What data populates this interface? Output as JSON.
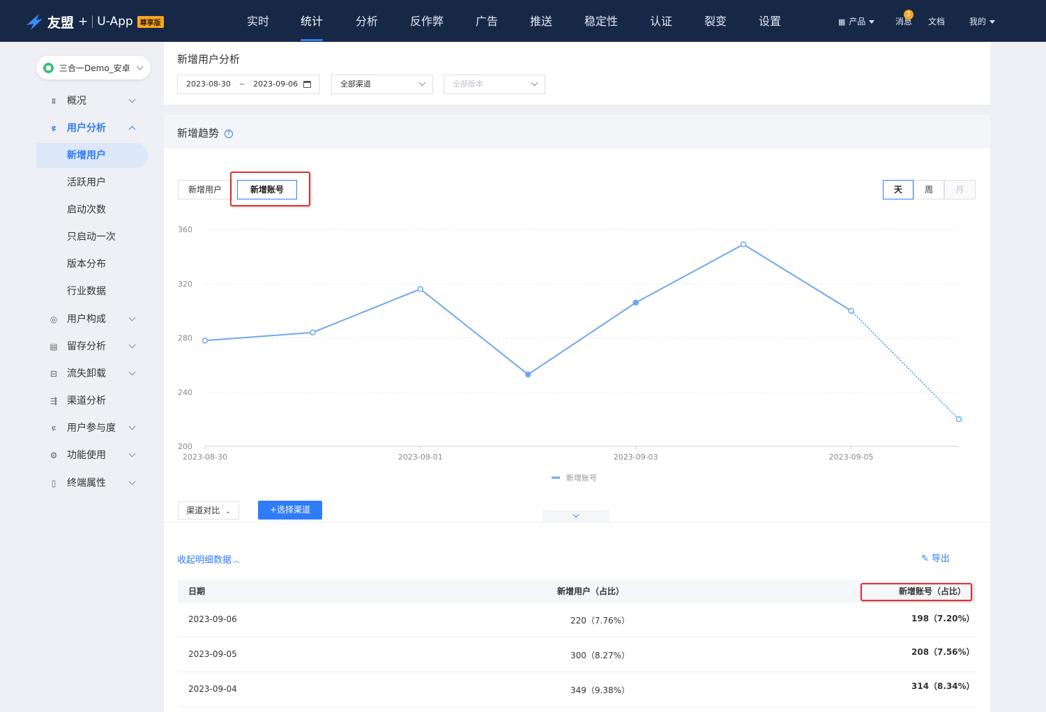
{
  "topnav": {
    "brand": "友盟",
    "plus": "+",
    "app": "U-App",
    "edition_badge": "尊享版",
    "items": [
      {
        "label": "实时"
      },
      {
        "label": "统计",
        "active": true
      },
      {
        "label": "分析"
      },
      {
        "label": "反作弊"
      },
      {
        "label": "广告"
      },
      {
        "label": "推送"
      },
      {
        "label": "稳定性"
      },
      {
        "label": "认证"
      },
      {
        "label": "裂变"
      },
      {
        "label": "设置"
      }
    ],
    "products_label": "产品",
    "messages_label": "消息",
    "messages_count": "2",
    "docs_label": "文档",
    "me_label": "我的"
  },
  "sidebar": {
    "app_selector": "三合一Demo_安卓",
    "items": [
      {
        "label": "概况",
        "icon": "chart-icon",
        "expandable": true
      },
      {
        "label": "用户分析",
        "icon": "user-analysis-icon",
        "expandable": true,
        "expanded": true
      },
      {
        "label": "新增用户",
        "sub": true,
        "active": true
      },
      {
        "label": "活跃用户",
        "sub": true
      },
      {
        "label": "启动次数",
        "sub": true
      },
      {
        "label": "只启动一次",
        "sub": true
      },
      {
        "label": "版本分布",
        "sub": true
      },
      {
        "label": "行业数据",
        "sub": true
      },
      {
        "label": "用户构成",
        "icon": "user-composition-icon",
        "expandable": true
      },
      {
        "label": "留存分析",
        "icon": "retention-icon",
        "expandable": true
      },
      {
        "label": "流失卸载",
        "icon": "churn-icon",
        "expandable": true
      },
      {
        "label": "渠道分析",
        "icon": "channel-icon",
        "expandable": false
      },
      {
        "label": "用户参与度",
        "icon": "engagement-icon",
        "expandable": true
      },
      {
        "label": "功能使用",
        "icon": "feature-icon",
        "expandable": true
      },
      {
        "label": "终端属性",
        "icon": "device-icon",
        "expandable": true
      }
    ]
  },
  "filters": {
    "title": "新增用户分析",
    "date_start": "2023-08-30",
    "date_sep": "~",
    "date_end": "2023-09-06",
    "channel": "全部渠道",
    "version_placeholder": "全部版本"
  },
  "trend": {
    "title": "新增趋势",
    "help": "?",
    "tabs": [
      {
        "label": "新增用户",
        "selected": false
      },
      {
        "label": "新增账号",
        "selected": true
      }
    ],
    "granularity": [
      {
        "label": "天",
        "selected": true
      },
      {
        "label": "周",
        "selected": false
      },
      {
        "label": "月",
        "disabled": true
      }
    ],
    "compare_label": "渠道对比",
    "select_channel_label": "+选择渠道"
  },
  "chart_data": {
    "type": "line",
    "x": [
      "2023-08-30",
      "2023-08-31",
      "2023-09-01",
      "2023-09-02",
      "2023-09-03",
      "2023-09-04",
      "2023-09-05",
      "2023-09-06"
    ],
    "x_tick_labels": [
      "2023-08-30",
      "2023-09-01",
      "2023-09-03",
      "2023-09-05"
    ],
    "y_tick_labels": [
      "200",
      "240",
      "280",
      "320",
      "360"
    ],
    "ylim": [
      200,
      360
    ],
    "series": [
      {
        "name": "新增账号",
        "values": [
          278,
          284,
          316,
          253,
          306,
          349,
          300,
          220
        ],
        "color": "#6ea8ee",
        "last_segment_dashed": true
      }
    ],
    "grid": true,
    "legend": "bottom-center"
  },
  "detail": {
    "collapse_label": "收起明细数据",
    "export_label": "导出",
    "columns": [
      "日期",
      "新增用户（占比）",
      "新增账号（占比）"
    ],
    "rows": [
      {
        "date": "2023-09-06",
        "new_users": "220（7.76%）",
        "new_accounts": "198（7.20%）"
      },
      {
        "date": "2023-09-05",
        "new_users": "300（8.27%）",
        "new_accounts": "208（7.56%）"
      },
      {
        "date": "2023-09-04",
        "new_users": "349（9.38%）",
        "new_accounts": "314（8.34%）"
      }
    ]
  },
  "colors": {
    "nav_bg": "#172847",
    "accent": "#2f7cf6",
    "highlight_box": "#e0312f",
    "badge": "#f5a623"
  }
}
